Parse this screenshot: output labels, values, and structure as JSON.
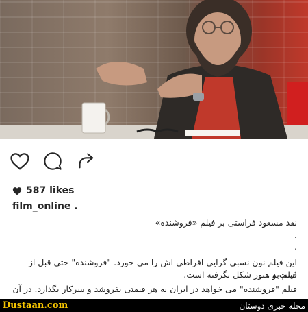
{
  "post": {
    "likes": "587 likes",
    "username": "film_online .",
    "caption_lines": [
      "نقد مسعود فراستی بر فیلم «فروشنده»",
      ".",
      ".",
      "این فیلم نون نسبی گرایی افراطی اش را می خورد. \"فروشنده\" حتی قبل از فیلم بد",
      "است و هنوز شکل نگرفته است.",
      "فیلم \"فروشنده\" می خواهد در ایران به هر قیمتی بفروشد و سرکار بگذارد. در آن"
    ]
  },
  "icons": {
    "like": "heart-icon",
    "comment": "comment-icon",
    "share": "share-icon",
    "likes_heart": "heart-filled-icon"
  },
  "footer": {
    "site": "Dustaan.com",
    "magazine": "مجله خبری دوستان"
  },
  "colors": {
    "footer_bg": "#000000",
    "site_text": "#f5c400",
    "text": "#262626"
  }
}
